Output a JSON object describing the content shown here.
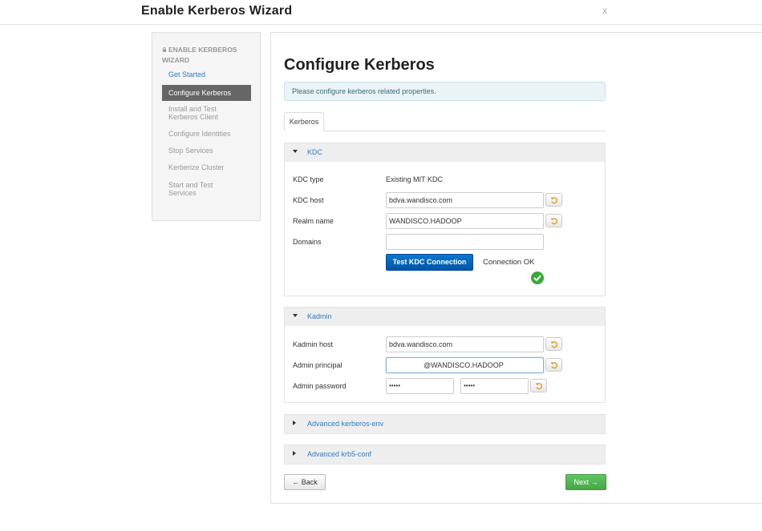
{
  "window": {
    "title": "Enable Kerberos Wizard",
    "close_label": "x"
  },
  "sidebar": {
    "heading": "ENABLE KERBEROS WIZARD",
    "items": [
      {
        "label": "Get Started"
      },
      {
        "label": "Configure Kerberos"
      },
      {
        "label": "Install and Test Kerberos Client"
      },
      {
        "label": "Configure Identities"
      },
      {
        "label": "Stop Services"
      },
      {
        "label": "Kerberize Cluster"
      },
      {
        "label": "Start and Test Services"
      }
    ]
  },
  "main": {
    "title": "Configure Kerberos",
    "alert": "Please configure kerberos related properties.",
    "tab": "Kerberos"
  },
  "kdc": {
    "title": "KDC",
    "type_label": "KDC type",
    "type_value": "Existing MIT KDC",
    "host_label": "KDC host",
    "host_value": "bdva.wandisco.com",
    "realm_label": "Realm name",
    "realm_value": "WANDISCO.HADOOP",
    "domains_label": "Domains",
    "domains_value": "",
    "test_button": "Test KDC Connection",
    "connection_status": "Connection OK"
  },
  "kadmin": {
    "title": "Kadmin",
    "host_label": "Kadmin host",
    "host_value": "bdva.wandisco.com",
    "principal_label": "Admin principal",
    "principal_value": "@WANDISCO.HADOOP",
    "password_label": "Admin password",
    "password_value": "•••••",
    "password_confirm_value": "•••••"
  },
  "advanced": {
    "env_title": "Advanced kerberos-env",
    "krb5_title": "Advanced krb5-conf"
  },
  "nav": {
    "back_label": "← Back",
    "next_label": "Next →"
  },
  "colors": {
    "link": "#2f7cc0",
    "primary": "#0062b9",
    "success": "#45a845",
    "active": "#666666"
  }
}
